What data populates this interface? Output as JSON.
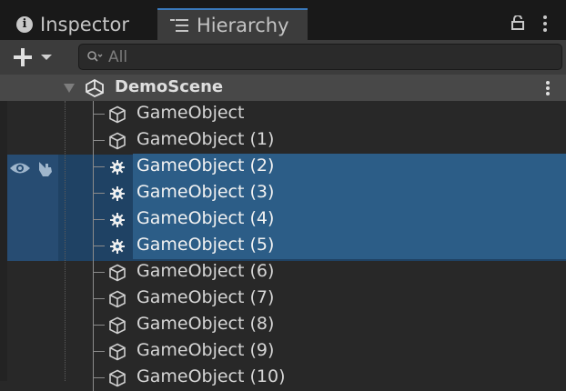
{
  "tabs": [
    {
      "label": "Inspector",
      "icon": "info-icon",
      "active": false
    },
    {
      "label": "Hierarchy",
      "icon": "hierarchy-icon",
      "active": true
    }
  ],
  "toolbar": {
    "add_label": "+",
    "search_placeholder": "All"
  },
  "scene": {
    "title": "DemoScene"
  },
  "objects": [
    {
      "label": "GameObject",
      "selected": false,
      "icon": "cube-icon"
    },
    {
      "label": "GameObject (1)",
      "selected": false,
      "icon": "cube-icon"
    },
    {
      "label": "GameObject (2)",
      "selected": true,
      "icon": "gear-icon"
    },
    {
      "label": "GameObject (3)",
      "selected": true,
      "icon": "gear-icon"
    },
    {
      "label": "GameObject (4)",
      "selected": true,
      "icon": "gear-icon"
    },
    {
      "label": "GameObject (5)",
      "selected": true,
      "icon": "gear-icon"
    },
    {
      "label": "GameObject (6)",
      "selected": false,
      "icon": "cube-icon"
    },
    {
      "label": "GameObject (7)",
      "selected": false,
      "icon": "cube-icon"
    },
    {
      "label": "GameObject (8)",
      "selected": false,
      "icon": "cube-icon"
    },
    {
      "label": "GameObject (9)",
      "selected": false,
      "icon": "cube-icon"
    },
    {
      "label": "GameObject (10)",
      "selected": false,
      "icon": "cube-icon"
    }
  ],
  "colors": {
    "background": "#282828",
    "selection": "#2c5d87",
    "tab_accent": "#3a79bb"
  }
}
